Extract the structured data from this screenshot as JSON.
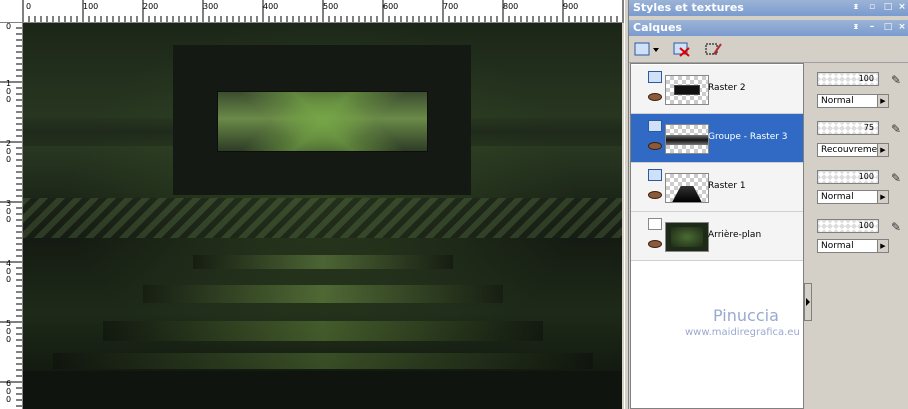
{
  "ruler": {
    "top_ticks": [
      "0",
      "100",
      "200",
      "300",
      "400",
      "500",
      "600",
      "700",
      "800",
      "900"
    ],
    "left_ticks": [
      "0",
      "100",
      "200",
      "300",
      "400",
      "500",
      "600"
    ]
  },
  "panels": {
    "styles_title": "Styles et textures",
    "layers_title": "Calques"
  },
  "layers": [
    {
      "name": "Raster 2",
      "opacity": "100",
      "blend": "Normal"
    },
    {
      "name": "Groupe - Raster 3",
      "opacity": "75",
      "blend": "Recouvrement"
    },
    {
      "name": "Raster 1",
      "opacity": "100",
      "blend": "Normal"
    },
    {
      "name": "Arrière-plan",
      "opacity": "100",
      "blend": "Normal"
    }
  ],
  "selected_layer_index": 1,
  "watermark": {
    "name": "Pinuccia",
    "url": "www.maidiregrafica.eu"
  },
  "icons": {
    "new_layer": "new-layer-icon",
    "delete_layer": "delete-layer-icon",
    "edit_selection": "edit-selection-icon",
    "visibility": "eye-icon",
    "link": "pen-link-icon"
  },
  "colors": {
    "titlebar": "#7a9bcf",
    "selected_row": "#316ac5",
    "watermark": "#9aa9d0"
  }
}
